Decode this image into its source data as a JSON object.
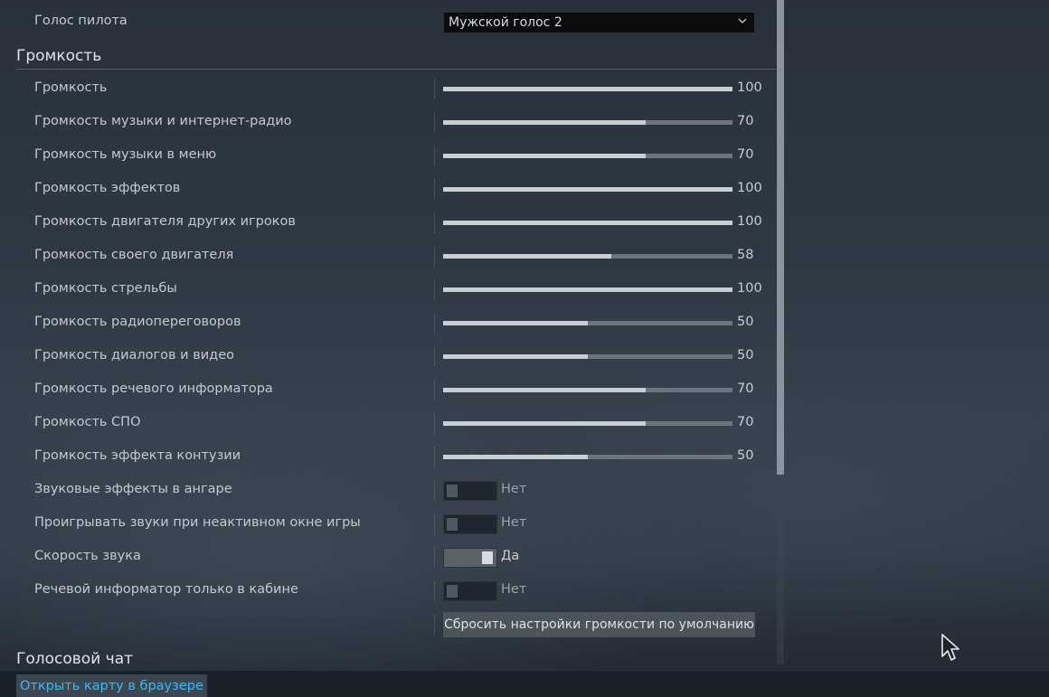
{
  "pilot_voice": {
    "label": "Голос пилота",
    "selected": "Мужской голос 2"
  },
  "volume_section": {
    "title": "Громкость",
    "sliders": [
      {
        "label": "Громкость",
        "value": 100
      },
      {
        "label": "Громкость музыки и интернет-радио",
        "value": 70
      },
      {
        "label": "Громкость музыки в меню",
        "value": 70
      },
      {
        "label": "Громкость эффектов",
        "value": 100
      },
      {
        "label": "Громкость двигателя других игроков",
        "value": 100
      },
      {
        "label": "Громкость своего двигателя",
        "value": 58
      },
      {
        "label": "Громкость стрельбы",
        "value": 100
      },
      {
        "label": "Громкость радиопереговоров",
        "value": 50
      },
      {
        "label": "Громкость диалогов и видео",
        "value": 50
      },
      {
        "label": "Громкость речевого информатора",
        "value": 70
      },
      {
        "label": "Громкость СПО",
        "value": 70
      },
      {
        "label": "Громкость эффекта контузии",
        "value": 50
      }
    ],
    "toggles": [
      {
        "label": "Звуковые эффекты в ангаре",
        "on": false,
        "state_text": "Нет"
      },
      {
        "label": "Проигрывать звуки при неактивном окне игры",
        "on": false,
        "state_text": "Нет"
      },
      {
        "label": "Скорость звука",
        "on": true,
        "state_text": "Да"
      },
      {
        "label": "Речевой информатор только в кабине",
        "on": false,
        "state_text": "Нет"
      }
    ],
    "reset_button": "Сбросить настройки громкости по умолчанию"
  },
  "voice_chat_section": {
    "title": "Голосовой чат"
  },
  "footer": {
    "open_map_link": "Открыть карту в браузере"
  },
  "icons": {
    "dropdown": "chevron-down-icon",
    "cursor": "mouse-cursor-icon"
  },
  "colors": {
    "slider_fill": "#c9ced3",
    "slider_track": "#6d747c",
    "link": "#3fb8f2"
  }
}
